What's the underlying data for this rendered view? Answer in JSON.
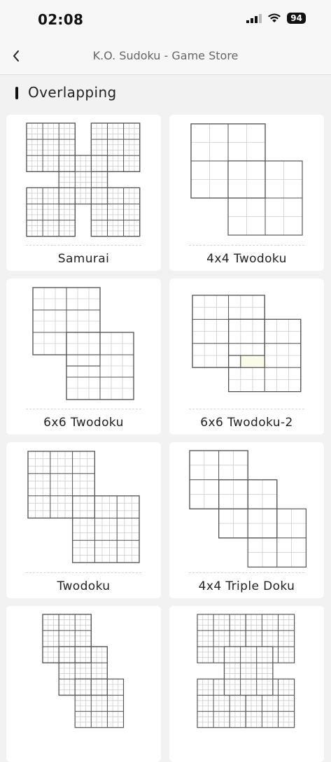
{
  "status_bar": {
    "time": "02:08",
    "battery": "94",
    "icons": [
      "signal-icon",
      "wifi-icon",
      "battery-icon"
    ]
  },
  "nav": {
    "title": "K.O. Sudoku - Game Store",
    "back_icon": "chevron-left-icon"
  },
  "section": {
    "title": "Overlapping"
  },
  "cards": [
    {
      "label": "Samurai"
    },
    {
      "label": "4x4 Twodoku"
    },
    {
      "label": "6x6 Twodoku"
    },
    {
      "label": "6x6 Twodoku-2"
    },
    {
      "label": "Twodoku"
    },
    {
      "label": "4x4 Triple Doku"
    },
    {
      "label": ""
    },
    {
      "label": ""
    }
  ],
  "colors": {
    "background": "#f2f2f2",
    "card": "#ffffff",
    "grid_line": "#555555",
    "grid_fine": "#cccccc",
    "overlap_fill": "#fbfbea"
  }
}
